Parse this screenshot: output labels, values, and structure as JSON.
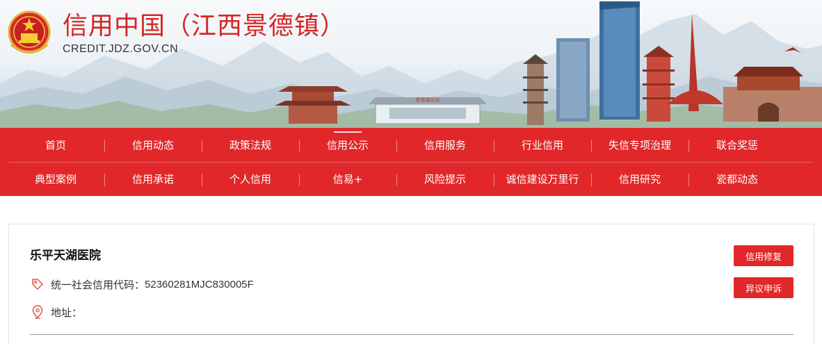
{
  "header": {
    "title": "信用中国（江西景德镇）",
    "domain": "CREDIT.JDZ.GOV.CN",
    "station_sign": "景德镇北站",
    "emblem_icon": "national-emblem-icon",
    "colors": {
      "brand_red": "#d42626"
    }
  },
  "nav": {
    "background": "#e12729",
    "active_index": 3,
    "row1": [
      "首页",
      "信用动态",
      "政策法规",
      "信用公示",
      "信用服务",
      "行业信用",
      "失信专项治理",
      "联合奖惩"
    ],
    "row2": [
      "典型案例",
      "信用承诺",
      "个人信用",
      "信易+",
      "风险提示",
      "诚信建设万里行",
      "信用研究",
      "瓷都动态"
    ]
  },
  "detail": {
    "org_name": "乐平天湖医院",
    "credit_code_label": "统一社会信用代码：",
    "credit_code_value": "52360281MJC830005F",
    "address_label": "地址：",
    "address_value": "",
    "credit_code_icon": "tag-icon",
    "address_icon": "location-pin-icon",
    "buttons": {
      "repair": "信用修复",
      "objection": "异议申诉"
    }
  }
}
